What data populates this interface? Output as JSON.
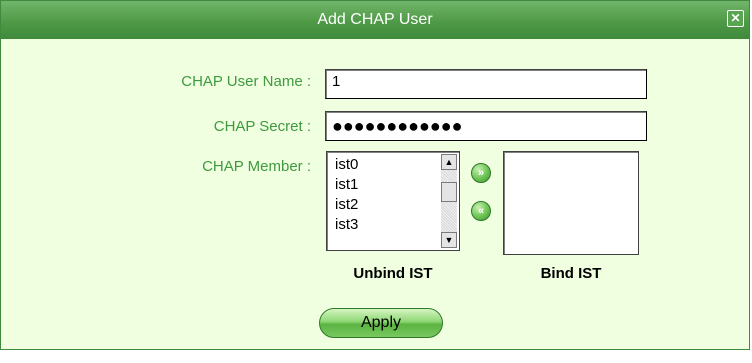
{
  "dialog": {
    "title": "Add CHAP User",
    "close_icon": "close-icon"
  },
  "form": {
    "user_name_label": "CHAP User Name :",
    "user_name_value": "1",
    "secret_label": "CHAP Secret :",
    "secret_value": "●●●●●●●●●●●●",
    "member_label": "CHAP Member :"
  },
  "unbind_list": {
    "caption": "Unbind IST",
    "items": [
      "ist0",
      "ist1",
      "ist2",
      "ist3"
    ]
  },
  "bind_list": {
    "caption": "Bind IST",
    "items": []
  },
  "buttons": {
    "add_icon": "double-chevron-right-icon",
    "remove_icon": "double-chevron-left-icon",
    "apply_label": "Apply"
  }
}
